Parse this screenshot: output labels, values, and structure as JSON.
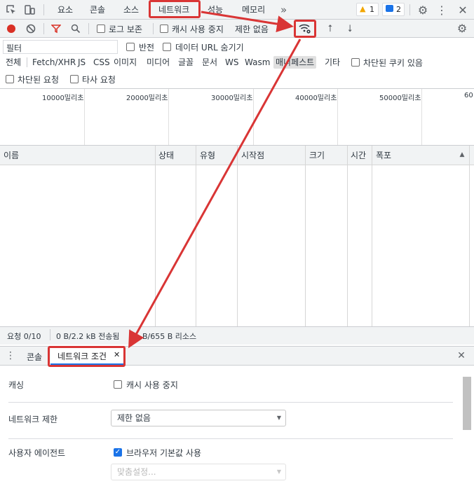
{
  "main_tabs": [
    {
      "label": "요소"
    },
    {
      "label": "콘솔"
    },
    {
      "label": "소스"
    },
    {
      "label": "네트워크"
    },
    {
      "label": "성능"
    },
    {
      "label": "메모리"
    }
  ],
  "more_tabs_glyph": "»",
  "badges": {
    "warnings": "1",
    "messages": "2"
  },
  "toolbar": {
    "preserve_log": "로그 보존",
    "disable_cache": "캐시 사용 중지",
    "throttling": "제한 없음"
  },
  "filter": {
    "placeholder": "필터",
    "invert": "반전",
    "hide_data_urls": "데이터 URL 숨기기"
  },
  "filter_types": [
    "전체",
    "Fetch/XHR",
    "JS",
    "CSS",
    "이미지",
    "미디어",
    "글꼴",
    "문서",
    "WS",
    "Wasm",
    "매니페스트",
    "기타"
  ],
  "blocked_cookies": "차단된 쿠키 있음",
  "blocked_requests": "차단된 요청",
  "third_party": "타사 요청",
  "timeline_ticks": [
    "10000밀리초",
    "20000밀리초",
    "30000밀리초",
    "40000밀리초",
    "50000밀리초",
    "60"
  ],
  "table_columns": [
    "이름",
    "상태",
    "유형",
    "시작점",
    "크기",
    "시간",
    "폭포"
  ],
  "status_bar": {
    "requests": "요청 0/10",
    "transferred": "0 B/2.2 kB 전송됨",
    "resources": "B/655 B 리소스"
  },
  "drawer": {
    "tab_console": "콘솔",
    "tab_network_conditions": "네트워크 조건",
    "caching_label": "캐싱",
    "caching_checkbox": "캐시 사용 중지",
    "throttling_label": "네트워크 제한",
    "throttling_value": "제한 없음",
    "user_agent_label": "사용자 에이전트",
    "user_agent_checkbox": "브라우저 기본값 사용",
    "user_agent_select": "맞춤설정..."
  },
  "colors": {
    "highlight": "#d93535",
    "record": "#d93025",
    "accent": "#1a73e8"
  }
}
